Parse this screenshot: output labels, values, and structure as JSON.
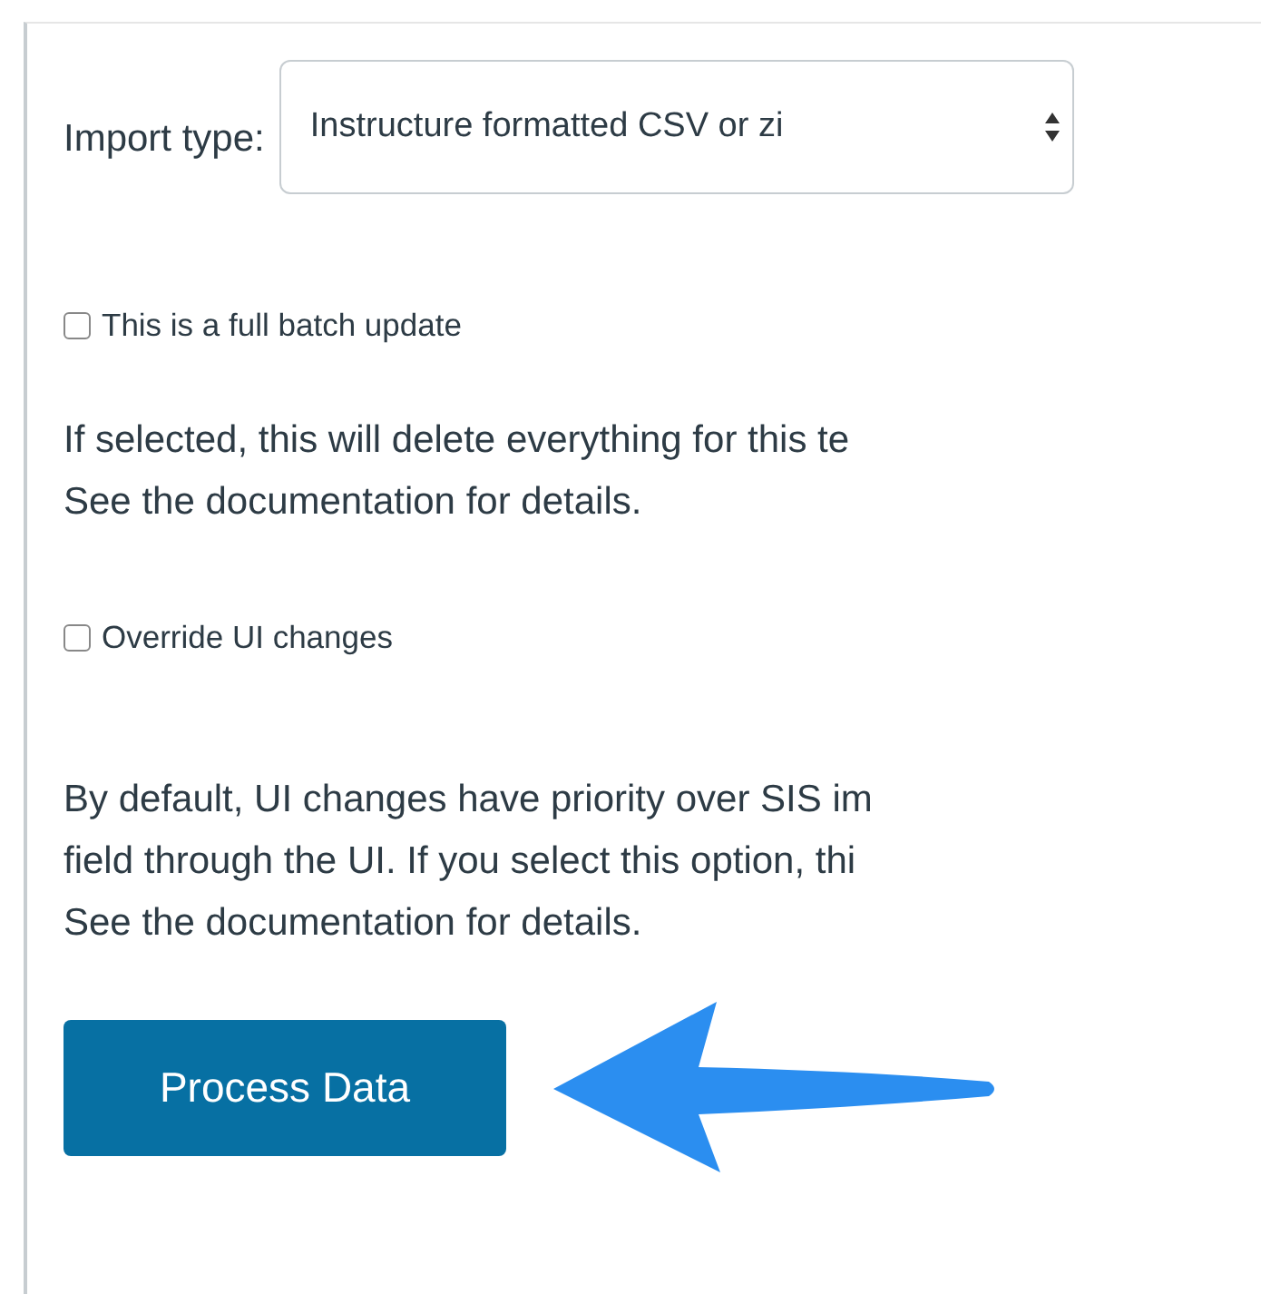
{
  "import_type": {
    "label": "Import type:",
    "value": "Instructure formatted CSV or zi"
  },
  "options": [
    {
      "label": "This is a full batch update",
      "checked": false,
      "description": [
        "If selected, this will delete everything for this te",
        "See the documentation for details."
      ]
    },
    {
      "label": "Override UI changes",
      "checked": false,
      "description": [
        "By default, UI changes have priority over SIS im",
        "field through the UI. If you select this option, thi",
        "See the documentation for details."
      ]
    }
  ],
  "button": {
    "label": "Process Data"
  }
}
